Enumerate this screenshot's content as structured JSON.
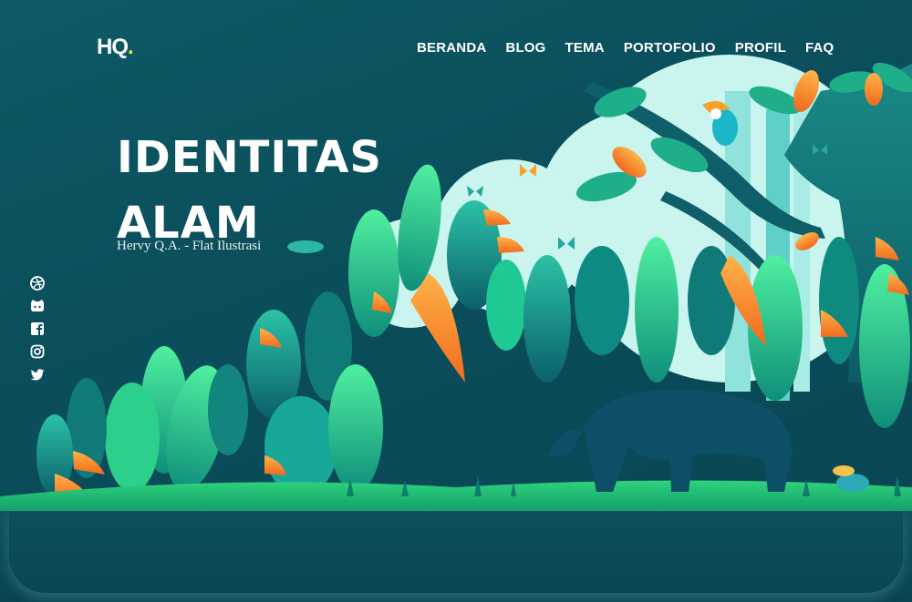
{
  "logo": {
    "text": "HQ",
    "dot": "."
  },
  "nav": {
    "items": [
      {
        "label": "BERANDA"
      },
      {
        "label": "BLOG"
      },
      {
        "label": "TEMA"
      },
      {
        "label": "PORTOFOLIO"
      },
      {
        "label": "PROFIL"
      },
      {
        "label": "FAQ"
      }
    ]
  },
  "hero": {
    "title_line1": "IDENTITAS",
    "title_line2": "ALAM",
    "subtitle": "Hervy Q.A. - Flat Ilustrasi"
  },
  "social": {
    "icons": [
      "dribbble-icon",
      "github-icon",
      "facebook-icon",
      "instagram-icon",
      "twitter-icon"
    ]
  },
  "colors": {
    "background": "#0b4f5c",
    "accent_logo_dot": "#e4ee2a",
    "jungle_green": "#2fd08a",
    "jungle_orange": "#f28a2a",
    "sky_mint": "#c6f5f0"
  }
}
